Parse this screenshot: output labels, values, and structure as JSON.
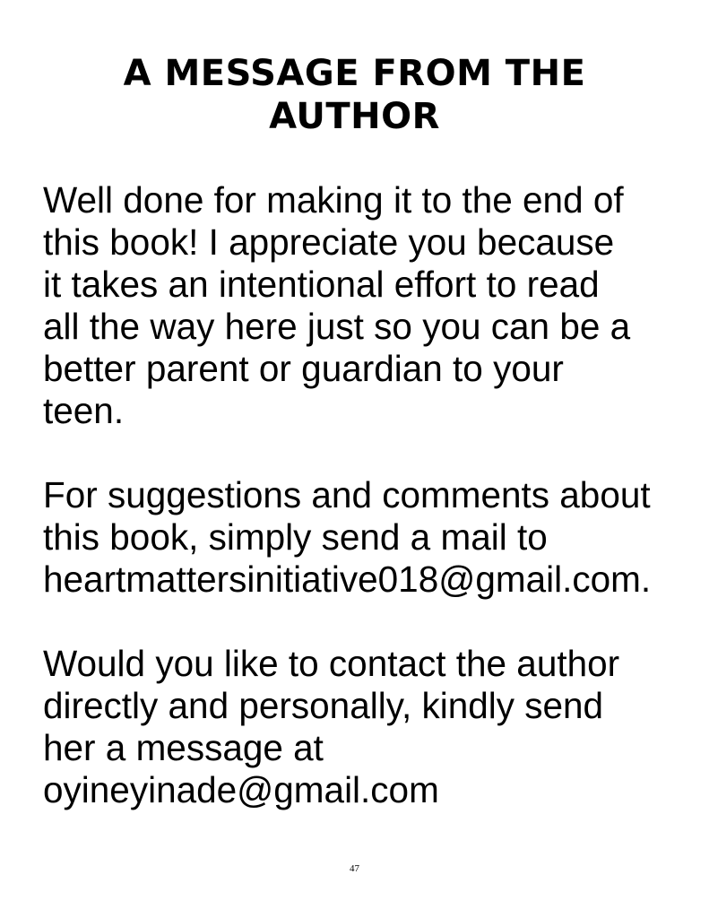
{
  "title": {
    "line1": "A MESSAGE FROM THE",
    "line2": "AUTHOR"
  },
  "paragraphs": [
    {
      "lines": [
        "Well done for making it to the end of",
        "this book! I appreciate you because",
        "it takes an intentional effort to read",
        "all the way here just so you can be a",
        "better parent or guardian to your",
        "teen."
      ]
    },
    {
      "lines": [
        "For suggestions and comments about",
        "this book, simply send a mail to",
        "heartmattersinitiative018@gmail.com."
      ]
    },
    {
      "lines": [
        "Would you like to contact the author",
        "directly and personally, kindly send",
        "her a message at",
        "oyineyinade@gmail.com"
      ]
    }
  ],
  "page_number": "47"
}
